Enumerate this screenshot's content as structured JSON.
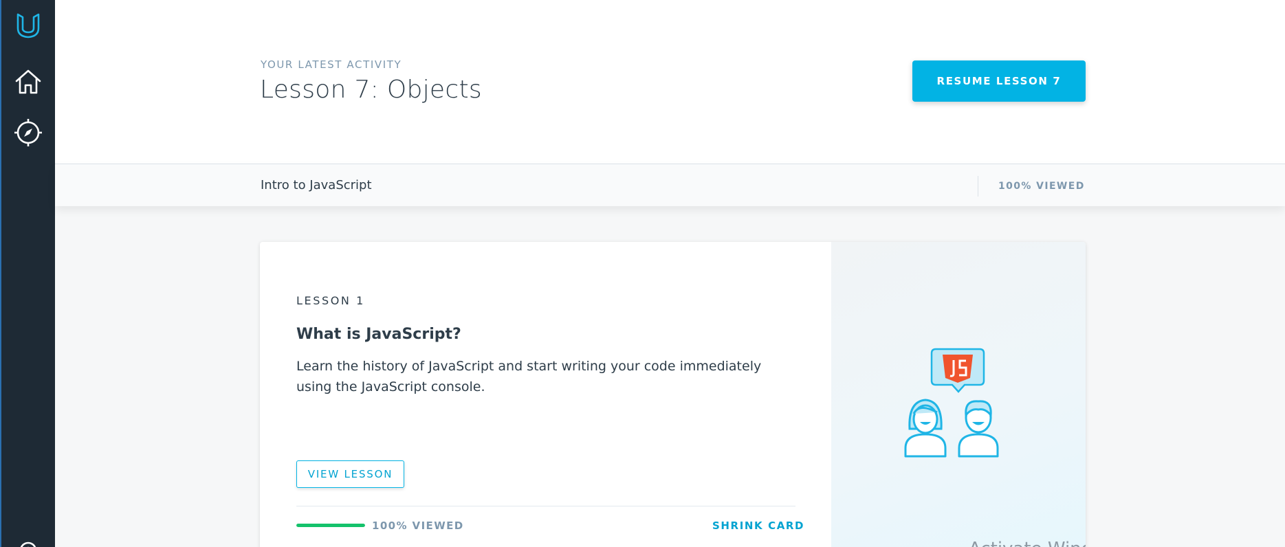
{
  "sidebar": {
    "logo_icon": "udacity-logo-icon",
    "items": [
      {
        "name": "home",
        "icon": "home-icon"
      },
      {
        "name": "explore",
        "icon": "compass-icon"
      },
      {
        "name": "settings",
        "icon": "gear-icon"
      }
    ]
  },
  "activity": {
    "eyebrow": "YOUR LATEST ACTIVITY",
    "title": "Lesson 7: Objects",
    "resume_label": "RESUME LESSON 7"
  },
  "course": {
    "name": "Intro to JavaScript",
    "progress_label": "100% VIEWED",
    "progress_fraction": 1.0
  },
  "card": {
    "lesson_number": "LESSON 1",
    "title": "What is JavaScript?",
    "description": "Learn the history of JavaScript and start writing your code immediately using the JavaScript console.",
    "view_label": "VIEW LESSON",
    "progress_label": "100% VIEWED",
    "progress_fraction": 1.0,
    "shrink_label": "SHRINK CARD",
    "illustration_icon": "javascript-chat-people-icon",
    "watermark": "Activate Windows"
  },
  "colors": {
    "accent": "#02b3e4",
    "sidebar": "#1e2a35",
    "progress": "#15c26b",
    "js_badge": "#f0542d"
  }
}
